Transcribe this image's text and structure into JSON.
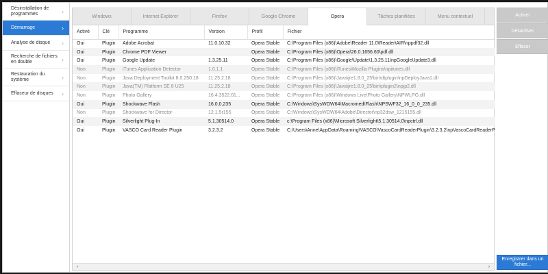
{
  "sidebar": {
    "items": [
      {
        "label": "Désinstallation de programmes",
        "active": false
      },
      {
        "label": "Démarrage",
        "active": true
      },
      {
        "label": "Analyse de disque",
        "active": false
      },
      {
        "label": "Recherche de fichiers en double",
        "active": false
      },
      {
        "label": "Restauration du système",
        "active": false
      },
      {
        "label": "Effaceur de disques",
        "active": false
      }
    ],
    "chevron_icon": "chevron-right-icon"
  },
  "tabs": [
    {
      "label": "Windows",
      "active": false
    },
    {
      "label": "Internet Explorer",
      "active": false
    },
    {
      "label": "Firefox",
      "active": false
    },
    {
      "label": "Google Chrome",
      "active": false
    },
    {
      "label": "Opera",
      "active": true
    },
    {
      "label": "Tâches planifiées",
      "active": false
    },
    {
      "label": "Menu contextuel",
      "active": false
    }
  ],
  "table": {
    "columns": [
      "Activé",
      "Clé",
      "Programme",
      "Version",
      "Profil",
      "Fichier"
    ],
    "rows": [
      [
        "Oui",
        "Plugin",
        "Adobe Acrobat",
        "11.0.10.32",
        "Opera Stable",
        "C:\\Program Files (x86)\\Adobe\\Reader 11.0\\Reader\\AIR\\nppdf32.dll"
      ],
      [
        "Oui",
        "Plugin",
        "Chrome PDF Viewer",
        "",
        "Opera Stable",
        "C:\\Program Files (x86)\\Opera\\26.0.1656.60\\pdf.dll"
      ],
      [
        "Oui",
        "Plugin",
        "Google Update",
        "1.3.25.11",
        "Opera Stable",
        "C:\\Program Files (x86)\\Google\\Update\\1.3.25.11\\npGoogleUpdate3.dll"
      ],
      [
        "Non",
        "Plugin",
        "iTunes Application Detector",
        "1.0.1.1",
        "Opera Stable",
        "C:\\Program Files (x86)\\iTunes\\Mozilla Plugins\\npitunes.dll"
      ],
      [
        "Non",
        "Plugin",
        "Java Deployment Toolkit 8.0.250.18",
        "11.25.2.18",
        "Opera Stable",
        "C:\\Program Files (x86)\\Java\\jre1.8.0_25\\bin\\dtplugin\\npDeployJava1.dll"
      ],
      [
        "Non",
        "Plugin",
        "Java(TM) Platform SE 8 U25",
        "11.25.2.18",
        "Opera Stable",
        "C:\\Program Files (x86)\\Java\\jre1.8.0_25\\bin\\plugin2\\npjp2.dll"
      ],
      [
        "Non",
        "Plugin",
        "Photo Gallery",
        "16.4.3522.01...",
        "Opera Stable",
        "C:\\Program Files (x86)\\Windows Live\\Photo Gallery\\NPWLPG.dll"
      ],
      [
        "Oui",
        "Plugin",
        "Shockwave Flash",
        "16,0,0,235",
        "Opera Stable",
        "C:\\Windows\\SysWOW64\\Macromed\\Flash\\NPSWF32_16_0_0_235.dll"
      ],
      [
        "Non",
        "Plugin",
        "Shockwave for Director",
        "12.1.5r155",
        "Opera Stable",
        "C:\\Windows\\SysWOW64\\Adobe\\Director\\np32dsw_1215155.dll"
      ],
      [
        "Oui",
        "Plugin",
        "Silverlight Plug-In",
        "5.1.30514.0",
        "Opera Stable",
        "c:\\Program Files (x86)\\Microsoft Silverlight\\5.1.30514.0\\npctrl.dll"
      ],
      [
        "Oui",
        "Plugin",
        "VASCO Card Reader Plugin",
        "3.2.3.2",
        "Opera Stable",
        "C:\\Users\\Anne\\AppData\\Roaming\\VASCO\\VascoCardReaderPlugin\\3.2.3.2\\npVascoCardReaderPl..."
      ]
    ]
  },
  "buttons": {
    "activate": "Activer",
    "deactivate": "Désactiver",
    "delete": "Effacer",
    "save": "Enregistrer dans un fichier..."
  },
  "colors": {
    "accent": "#2b7bd6",
    "button_disabled": "#c9c9c9"
  }
}
